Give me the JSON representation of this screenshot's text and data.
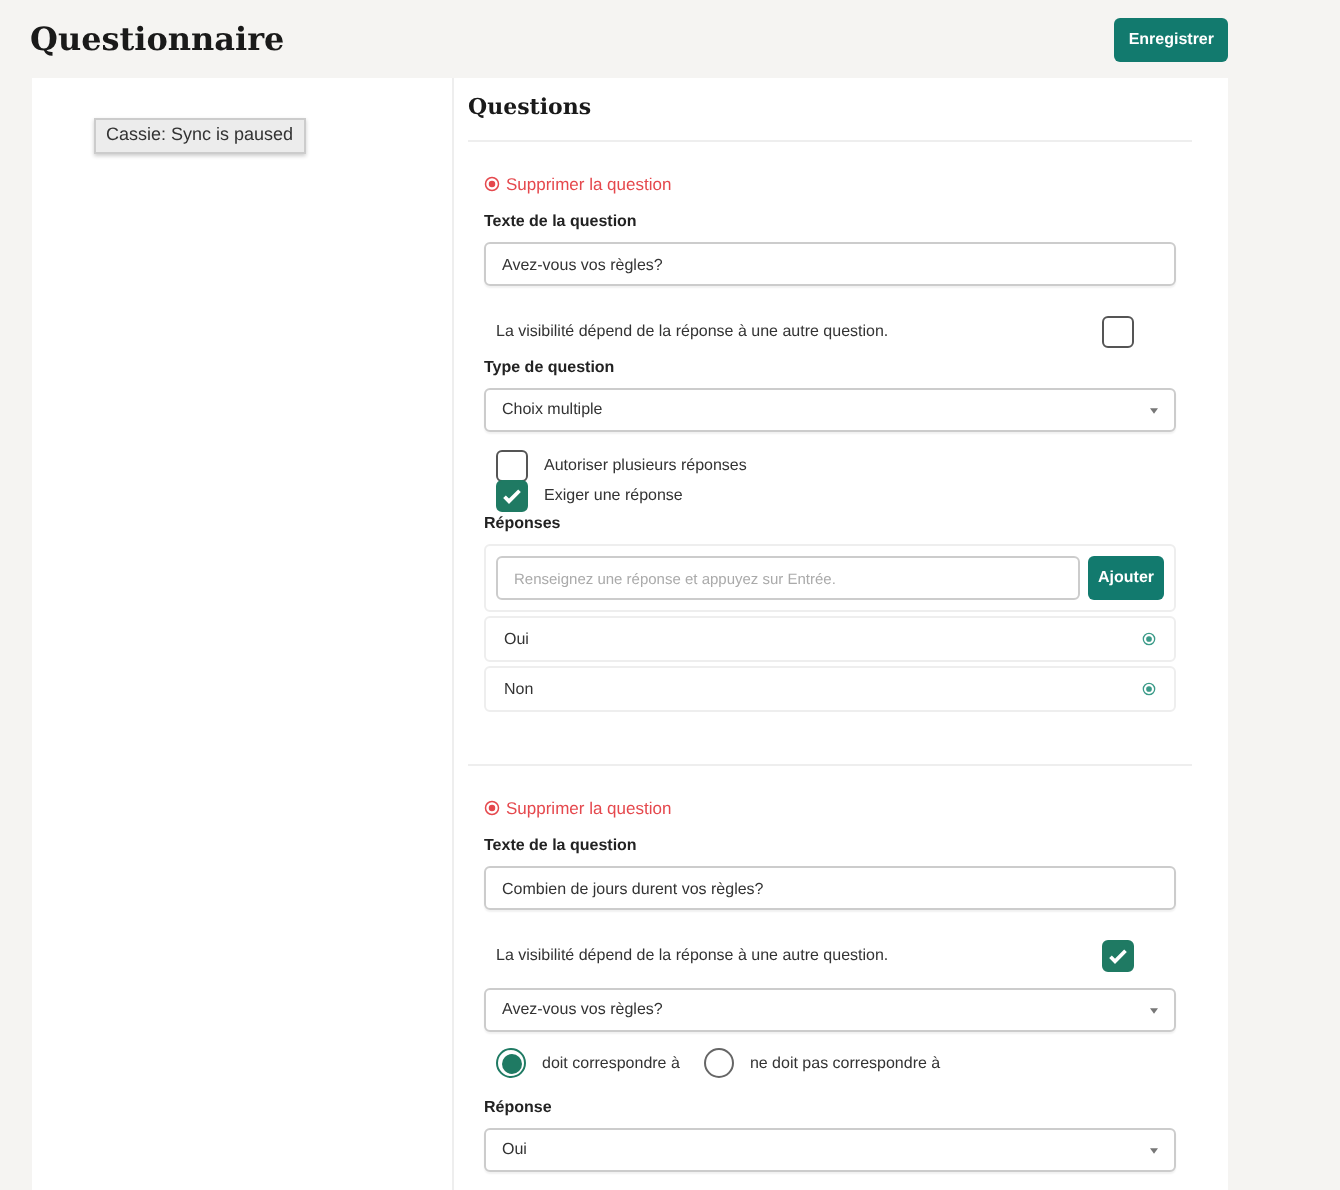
{
  "page": {
    "title": "Questionnaire",
    "save_button": "Enregistrer"
  },
  "tooltip": "Cassie: Sync is paused",
  "section_title": "Questions",
  "questions": [
    {
      "delete_link": "Supprimer la question",
      "text_label": "Texte de la question",
      "text_value": "Avez-vous vos règles?",
      "visibility_label": "La visibilité dépend de la réponse à une autre question.",
      "visibility_checked": false,
      "type_label": "Type de question",
      "type_value": "Choix multiple",
      "options": [
        {
          "label": "Autoriser plusieurs réponses",
          "checked": false
        },
        {
          "label": "Exiger une réponse",
          "checked": true
        }
      ],
      "answers_label": "Réponses",
      "answer_placeholder": "Renseignez une réponse et appuyez sur Entrée.",
      "add_button": "Ajouter",
      "answers": [
        "Oui",
        "Non"
      ]
    },
    {
      "delete_link": "Supprimer la question",
      "text_label": "Texte de la question",
      "text_value": "Combien de jours durent vos règles?",
      "visibility_label": "La visibilité dépend de la réponse à une autre question.",
      "visibility_checked": true,
      "depends_on": "Avez-vous vos règles?",
      "match": [
        {
          "label": "doit correspondre à",
          "selected": true
        },
        {
          "label": "ne doit pas correspondre à",
          "selected": false
        }
      ],
      "answer_label": "Réponse",
      "answer_value": "Oui"
    }
  ]
}
